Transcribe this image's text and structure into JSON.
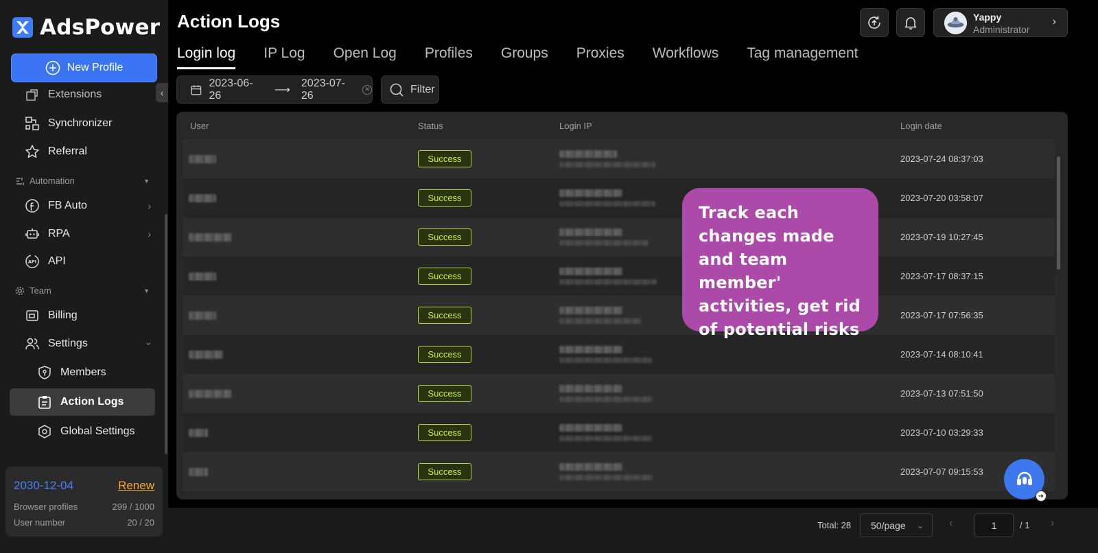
{
  "brand": {
    "name": "AdsPower"
  },
  "sidebar": {
    "new_profile_label": "New Profile",
    "items": [
      {
        "label": "Extensions",
        "icon": "extensions-icon"
      },
      {
        "label": "Synchronizer",
        "icon": "synchronizer-icon"
      },
      {
        "label": "Referral",
        "icon": "star-icon"
      }
    ],
    "automation": {
      "section_label": "Automation",
      "items": [
        {
          "label": "FB Auto",
          "icon": "facebook-icon"
        },
        {
          "label": "RPA",
          "icon": "robot-icon"
        },
        {
          "label": "API",
          "icon": "api-icon"
        }
      ]
    },
    "team": {
      "section_label": "Team",
      "items": [
        {
          "label": "Billing",
          "icon": "wallet-icon"
        },
        {
          "label": "Settings",
          "icon": "users-icon"
        }
      ],
      "settings_children": [
        {
          "label": "Members",
          "icon": "shield-icon"
        },
        {
          "label": "Action Logs",
          "icon": "clipboard-icon",
          "active": true
        },
        {
          "label": "Global Settings",
          "icon": "hexagon-gear-icon"
        }
      ]
    },
    "plan": {
      "expiry": "2030-12-04",
      "renew_label": "Renew",
      "browser_profiles_label": "Browser profiles",
      "browser_profiles_value": "299 / 1000",
      "user_number_label": "User number",
      "user_number_value": "20 / 20"
    }
  },
  "header": {
    "title": "Action Logs",
    "user": {
      "name": "Yappy",
      "role": "Administrator"
    }
  },
  "tabs": [
    {
      "label": "Login log",
      "active": true
    },
    {
      "label": "IP Log"
    },
    {
      "label": "Open Log"
    },
    {
      "label": "Profiles"
    },
    {
      "label": "Groups"
    },
    {
      "label": "Proxies"
    },
    {
      "label": "Workflows"
    },
    {
      "label": "Tag management"
    }
  ],
  "filters": {
    "date_from": "2023-06-26",
    "date_to": "2023-07-26",
    "filter_label": "Filter"
  },
  "table": {
    "columns": [
      "User",
      "Status",
      "Login IP",
      "Login date"
    ],
    "rows": [
      {
        "status": "Success",
        "date": "2023-07-24 08:37:03"
      },
      {
        "status": "Success",
        "date": "2023-07-20 03:58:07"
      },
      {
        "status": "Success",
        "date": "2023-07-19 10:27:45"
      },
      {
        "status": "Success",
        "date": "2023-07-17 08:37:15"
      },
      {
        "status": "Success",
        "date": "2023-07-17 07:56:35"
      },
      {
        "status": "Success",
        "date": "2023-07-14 08:10:41"
      },
      {
        "status": "Success",
        "date": "2023-07-13 07:51:50"
      },
      {
        "status": "Success",
        "date": "2023-07-10 03:29:33"
      },
      {
        "status": "Success",
        "date": "2023-07-07 09:15:53"
      }
    ]
  },
  "tooltip": {
    "text": "Track each changes made and team member' activities, get rid of potential risks"
  },
  "pagination": {
    "total": "Total: 28",
    "page_size": "50/page",
    "current_page": "1",
    "total_pages": "/ 1"
  },
  "colors": {
    "accent": "#3b74f5",
    "success": "#c9f040",
    "tooltip": "#ab4aa8",
    "renew": "#f0a93a"
  }
}
